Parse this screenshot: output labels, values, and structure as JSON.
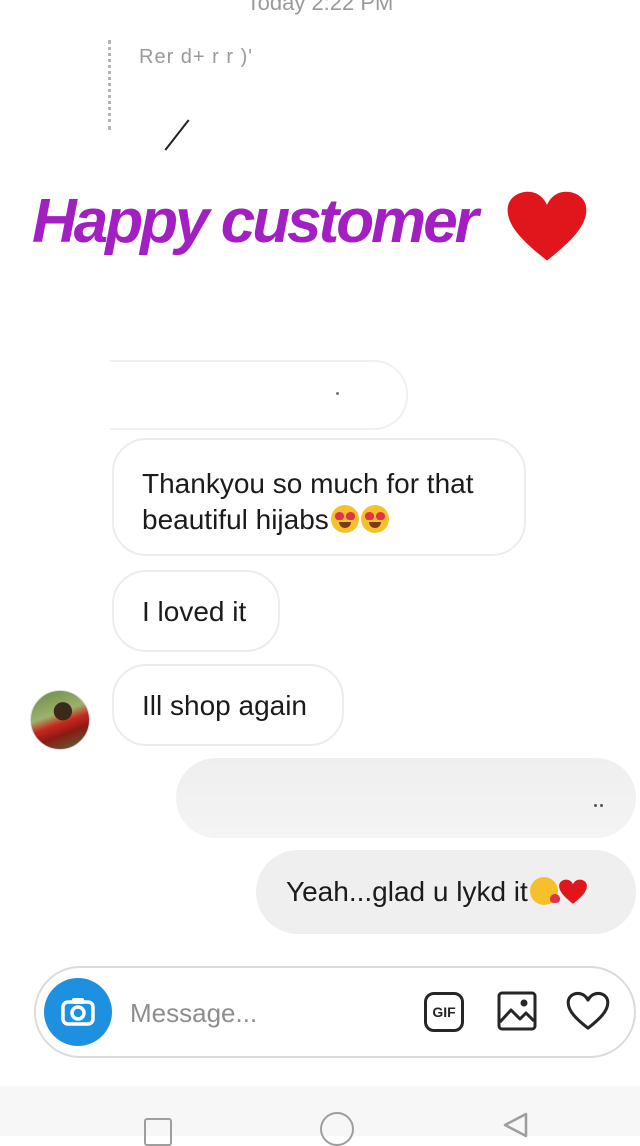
{
  "header": {
    "timestamp": "Today 2:22 PM",
    "reply_preview": "Rer  d+  r  r  )'"
  },
  "overlay": {
    "title": "Happy customer",
    "heart_icon": "red-heart-icon",
    "title_color": "#a21fc2"
  },
  "messages": {
    "incoming": [
      {
        "text": "Thankyou so much for that beautiful hijabs",
        "emoji": [
          "heart-eyes-emoji",
          "heart-eyes-emoji"
        ]
      },
      {
        "text": "I loved it"
      },
      {
        "text": "Ill shop again"
      }
    ],
    "outgoing": [
      {
        "text": "Yeah...glad u lykd it",
        "emoji": [
          "kissing-face-emoji",
          "red-heart-emoji"
        ]
      }
    ]
  },
  "composer": {
    "placeholder": "Message...",
    "gif_label": "GIF",
    "camera_icon": "camera-icon",
    "gallery_icon": "image-icon",
    "like_icon": "heart-outline-icon",
    "camera_color": "#1e90e0"
  },
  "navbar": {
    "icons": [
      "recent-apps-icon",
      "home-icon",
      "back-icon"
    ]
  }
}
